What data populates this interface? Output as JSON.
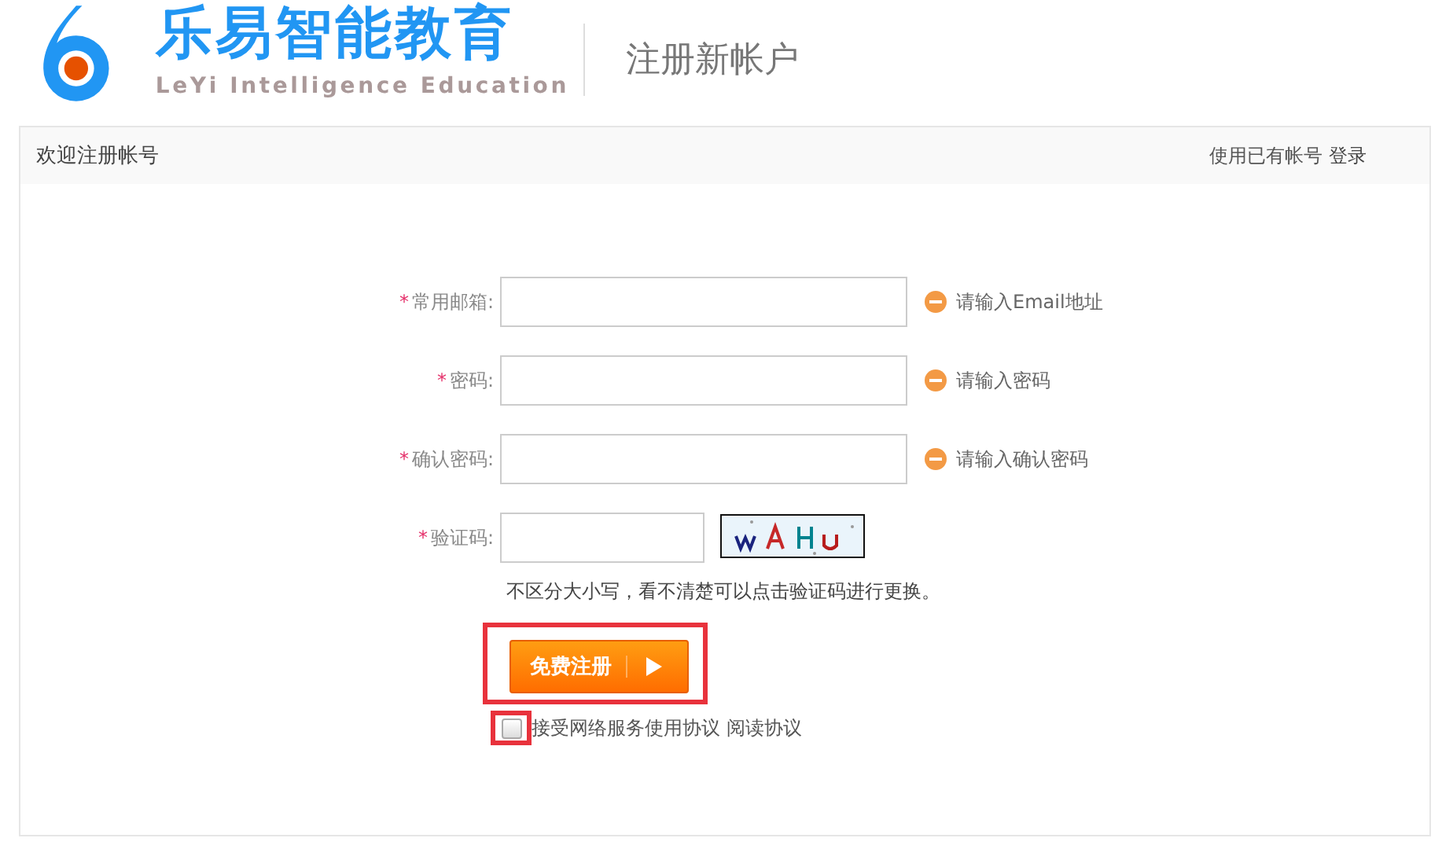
{
  "logo": {
    "title": "乐易智能教育",
    "subtitle": "LeYi Intelligence Education"
  },
  "page_title": "注册新帐户",
  "panel": {
    "title": "欢迎注册帐号",
    "login_prompt": "使用已有帐号",
    "login_link": "登录"
  },
  "fields": [
    {
      "kind": "text",
      "required_mark": "*",
      "label": "常用邮箱:",
      "hint": "请输入Email地址"
    },
    {
      "kind": "text",
      "required_mark": "*",
      "label": "密码:",
      "hint": "请输入密码"
    },
    {
      "kind": "text",
      "required_mark": "*",
      "label": "确认密码:",
      "hint": "请输入确认密码"
    },
    {
      "kind": "captcha",
      "required_mark": "*",
      "label": "验证码:"
    }
  ],
  "captcha_note": "不区分大小写，看不清楚可以点击验证码进行更换。",
  "submit": {
    "label": "免费注册",
    "highlighted": true
  },
  "agreement": {
    "checked": false,
    "highlighted": true,
    "text": "接受网络服务使用协议",
    "link": "阅读协议"
  }
}
